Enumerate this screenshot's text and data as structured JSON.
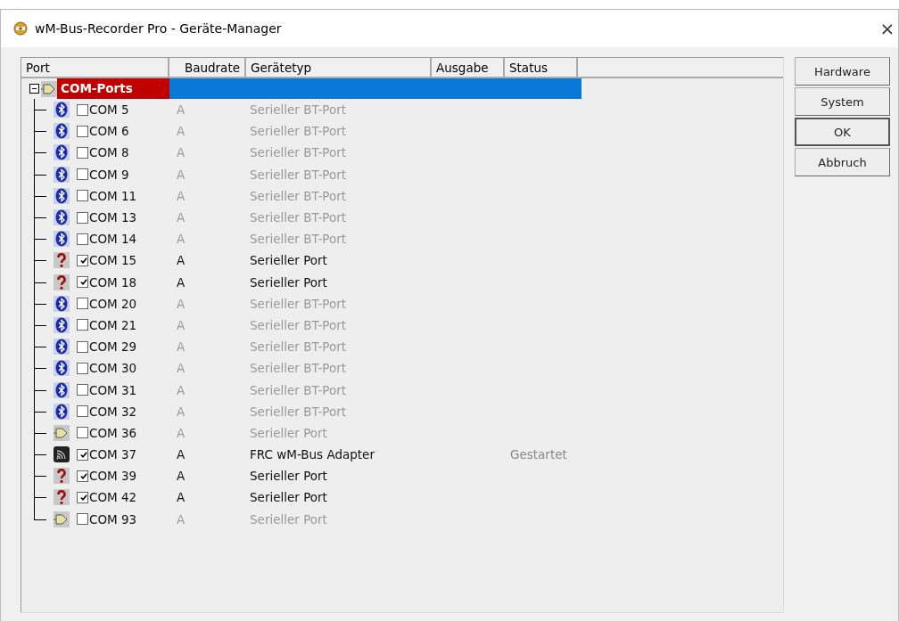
{
  "window": {
    "title": "wM-Bus-Recorder Pro - Geräte-Manager",
    "close": "×"
  },
  "table": {
    "columns": [
      "Port",
      "Baudrate",
      "Gerätetyp",
      "Ausgabe",
      "Status"
    ],
    "root": {
      "label": "COM-Ports",
      "expanded": true,
      "selected": true,
      "children": [
        {
          "kind": "bluetooth",
          "port": "COM  5",
          "checked": false,
          "baudrate": "A",
          "type": "Serieller BT-Port"
        },
        {
          "kind": "bluetooth",
          "port": "COM  6",
          "checked": false,
          "baudrate": "A",
          "type": "Serieller BT-Port"
        },
        {
          "kind": "bluetooth",
          "port": "COM  8",
          "checked": false,
          "baudrate": "A",
          "type": "Serieller BT-Port"
        },
        {
          "kind": "bluetooth",
          "port": "COM  9",
          "checked": false,
          "baudrate": "A",
          "type": "Serieller BT-Port"
        },
        {
          "kind": "bluetooth",
          "port": "COM  11",
          "checked": false,
          "baudrate": "A",
          "type": "Serieller BT-Port"
        },
        {
          "kind": "bluetooth",
          "port": "COM  13",
          "checked": false,
          "baudrate": "A",
          "type": "Serieller BT-Port"
        },
        {
          "kind": "bluetooth",
          "port": "COM  14",
          "checked": false,
          "baudrate": "A",
          "type": "Serieller BT-Port"
        },
        {
          "kind": "unknown",
          "port": "COM  15",
          "checked": true,
          "baudrate": "A",
          "type": "Serieller Port"
        },
        {
          "kind": "unknown",
          "port": "COM  18",
          "checked": true,
          "baudrate": "A",
          "type": "Serieller Port"
        },
        {
          "kind": "bluetooth",
          "port": "COM  20",
          "checked": false,
          "baudrate": "A",
          "type": "Serieller BT-Port"
        },
        {
          "kind": "bluetooth",
          "port": "COM  21",
          "checked": false,
          "baudrate": "A",
          "type": "Serieller BT-Port"
        },
        {
          "kind": "bluetooth",
          "port": "COM  29",
          "checked": false,
          "baudrate": "A",
          "type": "Serieller BT-Port"
        },
        {
          "kind": "bluetooth",
          "port": "COM  30",
          "checked": false,
          "baudrate": "A",
          "type": "Serieller BT-Port"
        },
        {
          "kind": "bluetooth",
          "port": "COM  31",
          "checked": false,
          "baudrate": "A",
          "type": "Serieller BT-Port"
        },
        {
          "kind": "bluetooth",
          "port": "COM  32",
          "checked": false,
          "baudrate": "A",
          "type": "Serieller BT-Port"
        },
        {
          "kind": "serial",
          "port": "COM  36",
          "checked": false,
          "baudrate": "A",
          "type": "Serieller Port"
        },
        {
          "kind": "adapter",
          "port": "COM  37",
          "checked": true,
          "baudrate": "A",
          "type": "FRC wM-Bus Adapter",
          "status": "Gestartet"
        },
        {
          "kind": "unknown",
          "port": "COM  39",
          "checked": true,
          "baudrate": "A",
          "type": "Serieller Port"
        },
        {
          "kind": "unknown",
          "port": "COM  42",
          "checked": true,
          "baudrate": "A",
          "type": "Serieller Port"
        },
        {
          "kind": "serial",
          "port": "COM  93",
          "checked": false,
          "baudrate": "A",
          "type": "Serieller Port"
        }
      ]
    }
  },
  "buttons": [
    {
      "label": "Hardware",
      "default": false
    },
    {
      "label": "System",
      "default": false
    },
    {
      "label": "OK",
      "default": true
    },
    {
      "label": "Abbruch",
      "default": false
    }
  ]
}
